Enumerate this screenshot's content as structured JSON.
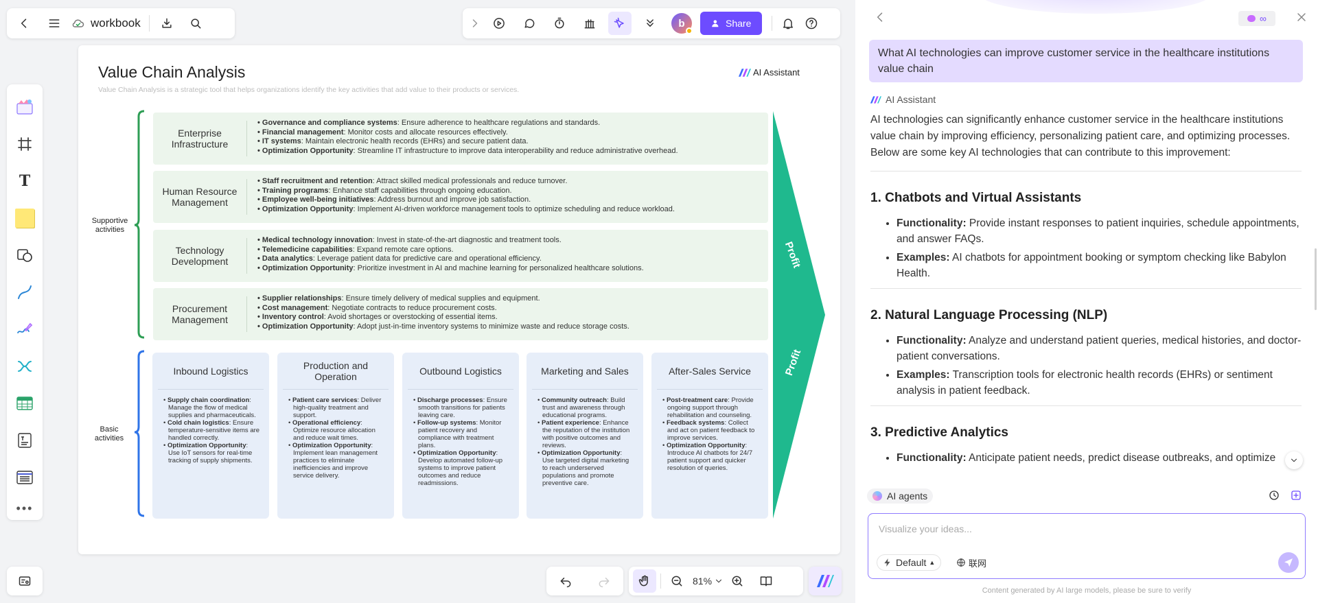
{
  "topbar": {
    "title": "workbook",
    "share_label": "Share"
  },
  "canvas": {
    "title": "Value Chain Analysis",
    "subtitle": "Value Chain Analysis is a strategic tool that helps organizations identify the key activities that add value to their products or services.",
    "brand": "AI Assistant",
    "supportive_label": "Supportive activities",
    "basic_label": "Basic activities",
    "profit_top": "Profit",
    "profit_bottom": "Profit",
    "supportive": [
      {
        "label": "Enterprise Infrastructure",
        "items": [
          {
            "b": "Governance and compliance systems",
            "t": ": Ensure adherence to healthcare regulations and standards."
          },
          {
            "b": "Financial management",
            "t": ": Monitor costs and allocate resources effectively."
          },
          {
            "b": "IT systems",
            "t": ": Maintain electronic health records (EHRs) and secure patient data."
          },
          {
            "b": "Optimization Opportunity",
            "t": ": Streamline IT infrastructure to improve data interoperability and reduce administrative overhead."
          }
        ]
      },
      {
        "label": "Human Resource Management",
        "items": [
          {
            "b": "Staff recruitment and retention",
            "t": ": Attract skilled medical professionals and reduce turnover."
          },
          {
            "b": "Training programs",
            "t": ": Enhance staff capabilities through ongoing education."
          },
          {
            "b": "Employee well-being initiatives",
            "t": ": Address burnout and improve job satisfaction."
          },
          {
            "b": "Optimization Opportunity",
            "t": ": Implement AI-driven workforce management tools to optimize scheduling and reduce workload."
          }
        ]
      },
      {
        "label": "Technology Development",
        "items": [
          {
            "b": "Medical technology innovation",
            "t": ": Invest in state-of-the-art diagnostic and treatment tools."
          },
          {
            "b": "Telemedicine capabilities",
            "t": ": Expand remote care options."
          },
          {
            "b": "Data analytics",
            "t": ": Leverage patient data for predictive care and operational efficiency."
          },
          {
            "b": "Optimization Opportunity",
            "t": ": Prioritize investment in AI and machine learning for personalized healthcare solutions."
          }
        ]
      },
      {
        "label": "Procurement Management",
        "items": [
          {
            "b": "Supplier relationships",
            "t": ": Ensure timely delivery of medical supplies and equipment."
          },
          {
            "b": "Cost management",
            "t": ": Negotiate contracts to reduce procurement costs."
          },
          {
            "b": "Inventory control",
            "t": ": Avoid shortages or overstocking of essential items."
          },
          {
            "b": "Optimization Opportunity",
            "t": ": Adopt just-in-time inventory systems to minimize waste and reduce storage costs."
          }
        ]
      }
    ],
    "basic": [
      {
        "label": "Inbound Logistics",
        "items": [
          {
            "b": "Supply chain coordination",
            "t": ": Manage the flow of medical supplies and pharmaceuticals."
          },
          {
            "b": "Cold chain logistics",
            "t": ": Ensure temperature-sensitive items are handled correctly."
          },
          {
            "b": "Optimization Opportunity",
            "t": ": Use IoT sensors for real-time tracking of supply shipments."
          }
        ]
      },
      {
        "label": "Production and Operation",
        "items": [
          {
            "b": "Patient care services",
            "t": ": Deliver high-quality treatment and support."
          },
          {
            "b": "Operational efficiency",
            "t": ": Optimize resource allocation and reduce wait times."
          },
          {
            "b": "Optimization Opportunity",
            "t": ": Implement lean management practices to eliminate inefficiencies and improve service delivery."
          }
        ]
      },
      {
        "label": "Outbound Logistics",
        "items": [
          {
            "b": "Discharge processes",
            "t": ": Ensure smooth transitions for patients leaving care."
          },
          {
            "b": "Follow-up systems",
            "t": ": Monitor patient recovery and compliance with treatment plans."
          },
          {
            "b": "Optimization Opportunity",
            "t": ": Develop automated follow-up systems to improve patient outcomes and reduce readmissions."
          }
        ]
      },
      {
        "label": "Marketing and Sales",
        "items": [
          {
            "b": "Community outreach",
            "t": ": Build trust and awareness through educational programs."
          },
          {
            "b": "Patient experience",
            "t": ": Enhance the reputation of the institution with positive outcomes and reviews."
          },
          {
            "b": "Optimization Opportunity",
            "t": ": Use targeted digital marketing to reach underserved populations and promote preventive care."
          }
        ]
      },
      {
        "label": "After-Sales Service",
        "items": [
          {
            "b": "Post-treatment care",
            "t": ": Provide ongoing support through rehabilitation and counseling."
          },
          {
            "b": "Feedback systems",
            "t": ": Collect and act on patient feedback to improve services."
          },
          {
            "b": "Optimization Opportunity",
            "t": ": Introduce AI chatbots for 24/7 patient support and quicker resolution of queries."
          }
        ]
      }
    ]
  },
  "zoom": {
    "level": "81%"
  },
  "chat": {
    "user_message": "What AI technologies can improve customer service in the healthcare institutions value chain",
    "assistant_name": "AI Assistant",
    "intro": "AI technologies can significantly enhance customer service in the healthcare institutions value chain by improving efficiency, personalizing patient care, and optimizing processes. Below are some key AI technologies that can contribute to this improvement:",
    "sections": [
      {
        "heading": "1. Chatbots and Virtual Assistants",
        "items": [
          {
            "b": "Functionality:",
            "t": " Provide instant responses to patient inquiries, schedule appointments, and answer FAQs."
          },
          {
            "b": "Examples:",
            "t": " AI chatbots for appointment booking or symptom checking like Babylon Health."
          }
        ]
      },
      {
        "heading": "2. Natural Language Processing (NLP)",
        "items": [
          {
            "b": "Functionality:",
            "t": " Analyze and understand patient queries, medical histories, and doctor-patient conversations."
          },
          {
            "b": "Examples:",
            "t": " Transcription tools for electronic health records (EHRs) or sentiment analysis in patient feedback."
          }
        ]
      },
      {
        "heading": "3. Predictive Analytics",
        "items": [
          {
            "b": "Functionality:",
            "t": " Anticipate patient needs, predict disease outbreaks, and optimize"
          }
        ]
      }
    ],
    "agents_label": "AI agents",
    "input_placeholder": "Visualize your ideas...",
    "mode_label": "Default",
    "web_label": "联网",
    "disclaimer": "Content generated by AI large models, please be sure to verify"
  }
}
